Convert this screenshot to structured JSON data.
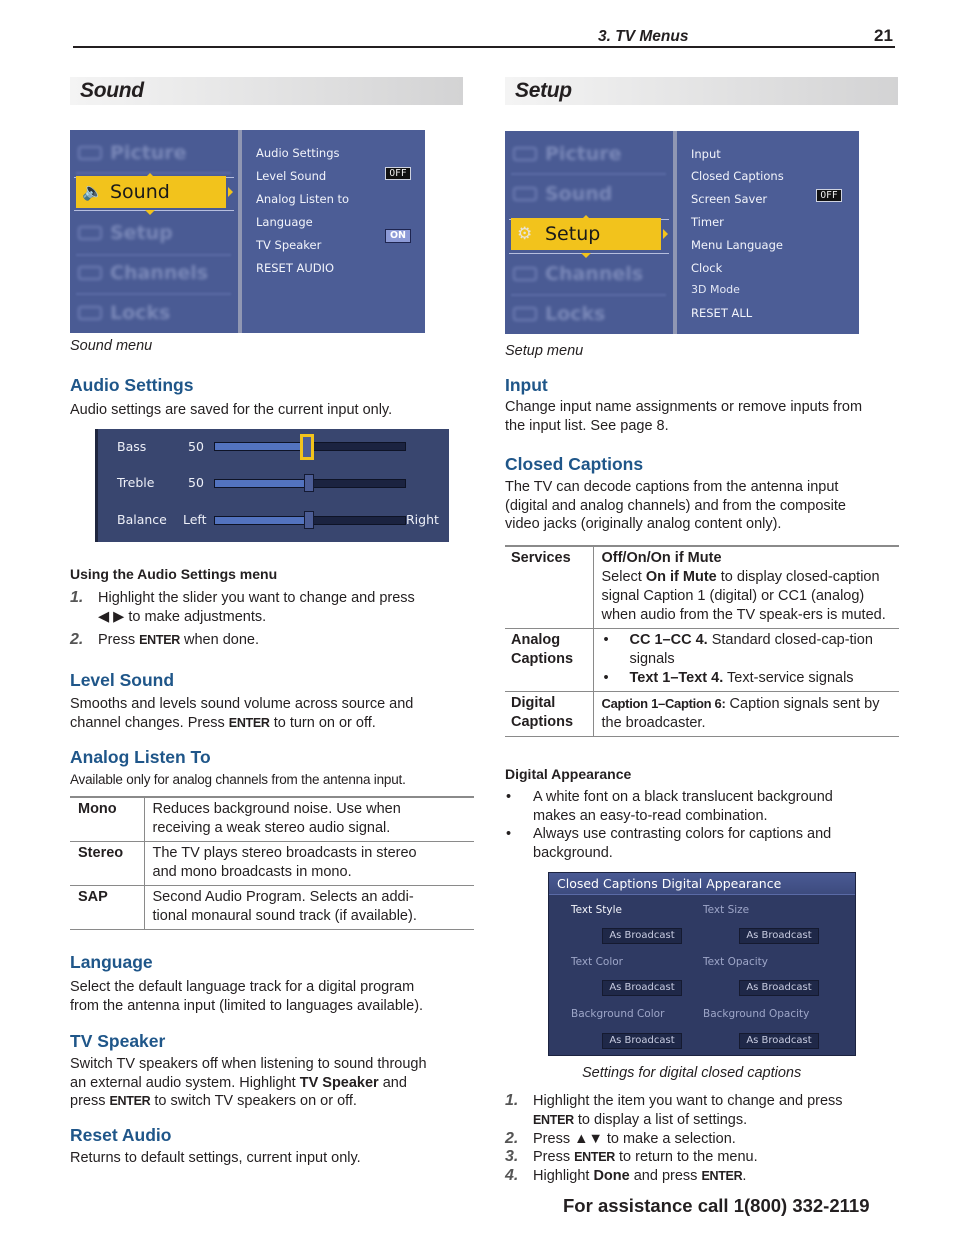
{
  "header": {
    "chapter": "3.  TV Menus",
    "page_number": "21"
  },
  "sound_section": {
    "title": "Sound",
    "menu": {
      "left_items": [
        "Picture",
        "Sound",
        "Setup",
        "Channels",
        "Locks"
      ],
      "selected": "Sound",
      "options": [
        "Audio Settings",
        "Level Sound",
        "Analog Listen to",
        "Language",
        "TV Speaker",
        "RESET AUDIO"
      ],
      "level_sound_state": "OFF",
      "tv_speaker_state": "ON",
      "caption": "Sound menu"
    },
    "audio_settings": {
      "heading": "Audio Settings",
      "body": "Audio settings are saved for the current input only.",
      "sliders": [
        {
          "label": "Bass",
          "value": "50",
          "level_percent": 50
        },
        {
          "label": "Treble",
          "value": "50",
          "level_percent": 50
        },
        {
          "label": "Balance",
          "left_label": "Left",
          "right_label": "Right",
          "level_percent": 50
        }
      ],
      "using_heading": "Using the Audio Settings menu",
      "steps": [
        {
          "num": "1.",
          "text_a": "Highlight the slider you want to change and press",
          "text_b": "◀ ▶ to make adjustments."
        },
        {
          "num": "2.",
          "pre": "Press ",
          "key": "ENTER",
          "post": " when done."
        }
      ]
    },
    "level_sound": {
      "heading": "Level Sound",
      "line1": "Smooths and levels sound volume across source and",
      "line2_pre": "channel changes.  Press ",
      "line2_key": "ENTER",
      "line2_post": " to turn on or off."
    },
    "analog_listen": {
      "heading": "Analog Listen To",
      "body": "Available only for analog channels from the antenna input.",
      "rows": [
        {
          "key": "Mono",
          "l1": "Reduces background noise.  Use when",
          "l2": "receiving a weak stereo audio signal."
        },
        {
          "key": "Stereo",
          "l1": "The TV plays stereo broadcasts in stereo",
          "l2": "and mono broadcasts in mono."
        },
        {
          "key": "SAP",
          "l1": "Second Audio Program.  Selects an addi-",
          "l2": "tional monaural sound track (if available)."
        }
      ]
    },
    "language": {
      "heading": "Language",
      "line1": "Select the default language track for a digital program",
      "line2": "from the antenna input (limited to languages available)."
    },
    "tv_speaker": {
      "heading": "TV Speaker",
      "line1": "Switch TV speakers off when listening to sound through",
      "line2_pre": "an external audio system.  Highlight ",
      "line2_bold": "TV Speaker",
      "line2_post": " and",
      "line3_pre": "press ",
      "line3_key": "ENTER",
      "line3_post": " to switch TV speakers on or off."
    },
    "reset_audio": {
      "heading": "Reset Audio",
      "body": "Returns to default settings, current input only."
    }
  },
  "setup_section": {
    "title": "Setup",
    "menu": {
      "left_items": [
        "Picture",
        "Sound",
        "Setup",
        "Channels",
        "Locks"
      ],
      "selected": "Setup",
      "options": [
        "Input",
        "Closed Captions",
        "Screen Saver",
        "Timer",
        "Menu Language",
        "Clock",
        "3D Mode",
        "RESET ALL"
      ],
      "screen_saver_state": "OFF",
      "caption": "Setup menu"
    },
    "input": {
      "heading": "Input",
      "line1": "Change input name assignments or remove inputs from",
      "line2": "the input list.  See page 8."
    },
    "closed_captions": {
      "heading": "Closed Captions",
      "line1": "The TV can decode captions from the antenna input",
      "line2": "(digital and analog channels) and from the composite",
      "line3": "video jacks (originally analog content only).",
      "table": {
        "services": {
          "key": "Services",
          "title": "Off/On/On if Mute",
          "pre": "Select ",
          "bold": "On if Mute",
          "post": " to display closed-caption signal Caption 1 (digital) or CC1 (analog) when audio from the TV speak-ers is muted."
        },
        "analog": {
          "key_l1": "Analog",
          "key_l2": "Captions",
          "items": [
            {
              "bold": "CC 1–CC 4.",
              "text": "  Standard closed-cap-tion signals"
            },
            {
              "bold": "Text 1–Text 4.",
              "text": "  Text-service signals"
            }
          ]
        },
        "digital": {
          "key_l1": "Digital",
          "key_l2": "Captions",
          "bold": "Caption 1–Caption 6:",
          "text": "  Caption signals sent by the broadcaster."
        }
      }
    },
    "digital_appearance": {
      "heading": "Digital Appearance",
      "bullets": [
        "A white font on a black translucent background makes an easy-to-read combination.",
        "Always use contrasting colors for captions and background."
      ],
      "panel": {
        "title": "Closed Captions Digital Appearance",
        "fields": [
          {
            "label": "Text Style",
            "value": "As Broadcast"
          },
          {
            "label": "Text Size",
            "value": "As Broadcast"
          },
          {
            "label": "Text Color",
            "value": "As Broadcast"
          },
          {
            "label": "Text Opacity",
            "value": "As Broadcast"
          },
          {
            "label": "Background Color",
            "value": "As Broadcast"
          },
          {
            "label": "Background Opacity",
            "value": "As Broadcast"
          }
        ]
      },
      "caption": "Settings for digital closed captions",
      "steps": [
        {
          "num": "1.",
          "l1": "Highlight the item you want to change and press",
          "key": "ENTER",
          "post": " to display a list of settings."
        },
        {
          "num": "2.",
          "pre": "Press  ",
          "arrows": "▲▼",
          "post": " to make a selection."
        },
        {
          "num": "3.",
          "pre": "Press ",
          "key": "ENTER",
          "post": " to return to the menu."
        },
        {
          "num": "4.",
          "pre": "Highlight ",
          "bold": "Done",
          "mid": " and press ",
          "key": "ENTER",
          "post": "."
        }
      ]
    }
  },
  "footer": {
    "assistance": "For assistance call 1(800) 332-2119"
  },
  "colors": {
    "heading_blue": "#1f5689",
    "menu_highlight": "#f2c31c",
    "menu_bg": "#4c5d96"
  }
}
